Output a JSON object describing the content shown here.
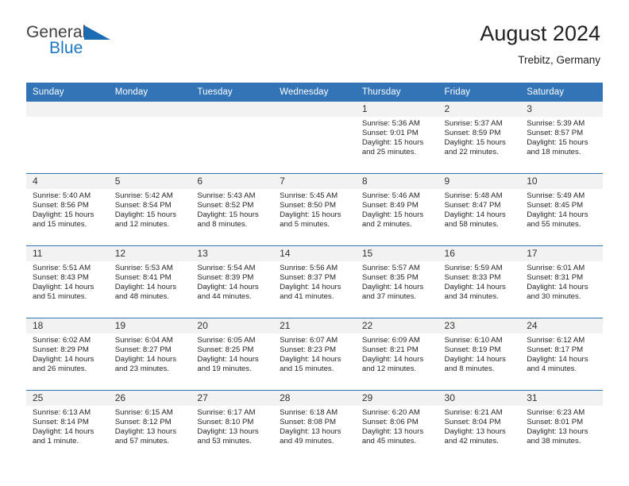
{
  "brand": {
    "name_top": "General",
    "name_bottom": "Blue",
    "triangle_icon": "blue-triangle-logo-mark",
    "accent_color": "#1b76c3"
  },
  "header": {
    "title": "August 2024",
    "subtitle": "Trebitz, Germany"
  },
  "colors": {
    "header_blue": "#3274b6",
    "daynum_gray": "#f2f2f2",
    "text": "#262626"
  },
  "calendar": {
    "weekday_headers": [
      "Sunday",
      "Monday",
      "Tuesday",
      "Wednesday",
      "Thursday",
      "Friday",
      "Saturday"
    ],
    "weeks": [
      [
        {
          "day": "",
          "empty": true,
          "sunrise": "",
          "sunset": "",
          "daylight1": "",
          "daylight2": ""
        },
        {
          "day": "",
          "empty": true,
          "sunrise": "",
          "sunset": "",
          "daylight1": "",
          "daylight2": ""
        },
        {
          "day": "",
          "empty": true,
          "sunrise": "",
          "sunset": "",
          "daylight1": "",
          "daylight2": ""
        },
        {
          "day": "",
          "empty": true,
          "sunrise": "",
          "sunset": "",
          "daylight1": "",
          "daylight2": ""
        },
        {
          "day": "1",
          "sunrise": "Sunrise: 5:36 AM",
          "sunset": "Sunset: 9:01 PM",
          "daylight1": "Daylight: 15 hours",
          "daylight2": "and 25 minutes."
        },
        {
          "day": "2",
          "sunrise": "Sunrise: 5:37 AM",
          "sunset": "Sunset: 8:59 PM",
          "daylight1": "Daylight: 15 hours",
          "daylight2": "and 22 minutes."
        },
        {
          "day": "3",
          "sunrise": "Sunrise: 5:39 AM",
          "sunset": "Sunset: 8:57 PM",
          "daylight1": "Daylight: 15 hours",
          "daylight2": "and 18 minutes."
        }
      ],
      [
        {
          "day": "4",
          "sunrise": "Sunrise: 5:40 AM",
          "sunset": "Sunset: 8:56 PM",
          "daylight1": "Daylight: 15 hours",
          "daylight2": "and 15 minutes."
        },
        {
          "day": "5",
          "sunrise": "Sunrise: 5:42 AM",
          "sunset": "Sunset: 8:54 PM",
          "daylight1": "Daylight: 15 hours",
          "daylight2": "and 12 minutes."
        },
        {
          "day": "6",
          "sunrise": "Sunrise: 5:43 AM",
          "sunset": "Sunset: 8:52 PM",
          "daylight1": "Daylight: 15 hours",
          "daylight2": "and 8 minutes."
        },
        {
          "day": "7",
          "sunrise": "Sunrise: 5:45 AM",
          "sunset": "Sunset: 8:50 PM",
          "daylight1": "Daylight: 15 hours",
          "daylight2": "and 5 minutes."
        },
        {
          "day": "8",
          "sunrise": "Sunrise: 5:46 AM",
          "sunset": "Sunset: 8:49 PM",
          "daylight1": "Daylight: 15 hours",
          "daylight2": "and 2 minutes."
        },
        {
          "day": "9",
          "sunrise": "Sunrise: 5:48 AM",
          "sunset": "Sunset: 8:47 PM",
          "daylight1": "Daylight: 14 hours",
          "daylight2": "and 58 minutes."
        },
        {
          "day": "10",
          "sunrise": "Sunrise: 5:49 AM",
          "sunset": "Sunset: 8:45 PM",
          "daylight1": "Daylight: 14 hours",
          "daylight2": "and 55 minutes."
        }
      ],
      [
        {
          "day": "11",
          "sunrise": "Sunrise: 5:51 AM",
          "sunset": "Sunset: 8:43 PM",
          "daylight1": "Daylight: 14 hours",
          "daylight2": "and 51 minutes."
        },
        {
          "day": "12",
          "sunrise": "Sunrise: 5:53 AM",
          "sunset": "Sunset: 8:41 PM",
          "daylight1": "Daylight: 14 hours",
          "daylight2": "and 48 minutes."
        },
        {
          "day": "13",
          "sunrise": "Sunrise: 5:54 AM",
          "sunset": "Sunset: 8:39 PM",
          "daylight1": "Daylight: 14 hours",
          "daylight2": "and 44 minutes."
        },
        {
          "day": "14",
          "sunrise": "Sunrise: 5:56 AM",
          "sunset": "Sunset: 8:37 PM",
          "daylight1": "Daylight: 14 hours",
          "daylight2": "and 41 minutes."
        },
        {
          "day": "15",
          "sunrise": "Sunrise: 5:57 AM",
          "sunset": "Sunset: 8:35 PM",
          "daylight1": "Daylight: 14 hours",
          "daylight2": "and 37 minutes."
        },
        {
          "day": "16",
          "sunrise": "Sunrise: 5:59 AM",
          "sunset": "Sunset: 8:33 PM",
          "daylight1": "Daylight: 14 hours",
          "daylight2": "and 34 minutes."
        },
        {
          "day": "17",
          "sunrise": "Sunrise: 6:01 AM",
          "sunset": "Sunset: 8:31 PM",
          "daylight1": "Daylight: 14 hours",
          "daylight2": "and 30 minutes."
        }
      ],
      [
        {
          "day": "18",
          "sunrise": "Sunrise: 6:02 AM",
          "sunset": "Sunset: 8:29 PM",
          "daylight1": "Daylight: 14 hours",
          "daylight2": "and 26 minutes."
        },
        {
          "day": "19",
          "sunrise": "Sunrise: 6:04 AM",
          "sunset": "Sunset: 8:27 PM",
          "daylight1": "Daylight: 14 hours",
          "daylight2": "and 23 minutes."
        },
        {
          "day": "20",
          "sunrise": "Sunrise: 6:05 AM",
          "sunset": "Sunset: 8:25 PM",
          "daylight1": "Daylight: 14 hours",
          "daylight2": "and 19 minutes."
        },
        {
          "day": "21",
          "sunrise": "Sunrise: 6:07 AM",
          "sunset": "Sunset: 8:23 PM",
          "daylight1": "Daylight: 14 hours",
          "daylight2": "and 15 minutes."
        },
        {
          "day": "22",
          "sunrise": "Sunrise: 6:09 AM",
          "sunset": "Sunset: 8:21 PM",
          "daylight1": "Daylight: 14 hours",
          "daylight2": "and 12 minutes."
        },
        {
          "day": "23",
          "sunrise": "Sunrise: 6:10 AM",
          "sunset": "Sunset: 8:19 PM",
          "daylight1": "Daylight: 14 hours",
          "daylight2": "and 8 minutes."
        },
        {
          "day": "24",
          "sunrise": "Sunrise: 6:12 AM",
          "sunset": "Sunset: 8:17 PM",
          "daylight1": "Daylight: 14 hours",
          "daylight2": "and 4 minutes."
        }
      ],
      [
        {
          "day": "25",
          "sunrise": "Sunrise: 6:13 AM",
          "sunset": "Sunset: 8:14 PM",
          "daylight1": "Daylight: 14 hours",
          "daylight2": "and 1 minute."
        },
        {
          "day": "26",
          "sunrise": "Sunrise: 6:15 AM",
          "sunset": "Sunset: 8:12 PM",
          "daylight1": "Daylight: 13 hours",
          "daylight2": "and 57 minutes."
        },
        {
          "day": "27",
          "sunrise": "Sunrise: 6:17 AM",
          "sunset": "Sunset: 8:10 PM",
          "daylight1": "Daylight: 13 hours",
          "daylight2": "and 53 minutes."
        },
        {
          "day": "28",
          "sunrise": "Sunrise: 6:18 AM",
          "sunset": "Sunset: 8:08 PM",
          "daylight1": "Daylight: 13 hours",
          "daylight2": "and 49 minutes."
        },
        {
          "day": "29",
          "sunrise": "Sunrise: 6:20 AM",
          "sunset": "Sunset: 8:06 PM",
          "daylight1": "Daylight: 13 hours",
          "daylight2": "and 45 minutes."
        },
        {
          "day": "30",
          "sunrise": "Sunrise: 6:21 AM",
          "sunset": "Sunset: 8:04 PM",
          "daylight1": "Daylight: 13 hours",
          "daylight2": "and 42 minutes."
        },
        {
          "day": "31",
          "sunrise": "Sunrise: 6:23 AM",
          "sunset": "Sunset: 8:01 PM",
          "daylight1": "Daylight: 13 hours",
          "daylight2": "and 38 minutes."
        }
      ]
    ]
  }
}
